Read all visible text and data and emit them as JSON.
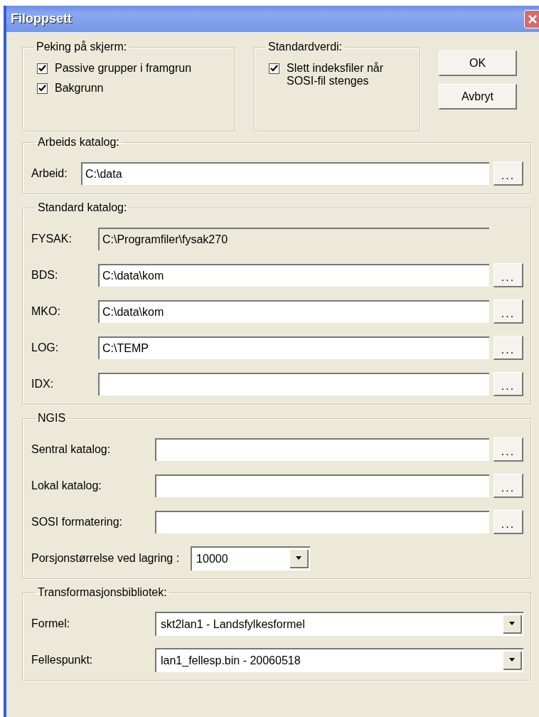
{
  "window": {
    "title": "Filoppsett"
  },
  "display_group": {
    "title": "Peking på skjerm:",
    "options": [
      {
        "label": "Passive grupper i framgrun",
        "checked": true
      },
      {
        "label": "Bakgrunn",
        "checked": true
      }
    ]
  },
  "default_group": {
    "title": "Standardverdi:",
    "options": [
      {
        "label": "Slett indeksfiler når SOSI-fil stenges",
        "checked": true
      }
    ]
  },
  "buttons": [
    "OK",
    "Avbryt"
  ],
  "sections": [
    {
      "title": "Arbeids katalog:",
      "rows": [
        {
          "kind": "path",
          "label": "Arbeid:",
          "value": "C:\\data",
          "disabled": false,
          "browse": "..."
        }
      ]
    },
    {
      "title": "Standard katalog:",
      "rows": [
        {
          "kind": "path",
          "label": "FYSAK:",
          "value": "C:\\Programfiler\\fysak270",
          "disabled": true
        },
        {
          "kind": "path",
          "label": "BDS:",
          "value": "C:\\data\\kom",
          "disabled": false,
          "browse": "..."
        },
        {
          "kind": "path",
          "label": "MKO:",
          "value": "C:\\data\\kom",
          "disabled": false,
          "browse": "..."
        },
        {
          "kind": "path",
          "label": "LOG:",
          "value": "C:\\TEMP",
          "disabled": false,
          "browse": "..."
        },
        {
          "kind": "path",
          "label": "IDX:",
          "disabled": false,
          "browse": "..."
        }
      ]
    },
    {
      "title": "NGIS",
      "rows": [
        {
          "kind": "path",
          "label": "Sentral katalog:",
          "disabled": false,
          "browse": "..."
        },
        {
          "kind": "path",
          "label": "Lokal katalog:",
          "disabled": false,
          "browse": "..."
        },
        {
          "kind": "path",
          "label": "SOSI formatering:",
          "disabled": false,
          "browse": "..."
        },
        {
          "kind": "combo",
          "label": "Porsjonstørrelse ved lagring :",
          "value": "10000"
        }
      ]
    },
    {
      "title": "Transformasjonsbibliotek:",
      "rows": [
        {
          "kind": "combo-wide",
          "label": "Formel:",
          "value": "skt2lan1 - Landsfylkesformel"
        },
        {
          "kind": "combo-wide",
          "label": "Fellespunkt:",
          "value": "lan1_fellesp.bin - 20060518"
        }
      ]
    }
  ]
}
